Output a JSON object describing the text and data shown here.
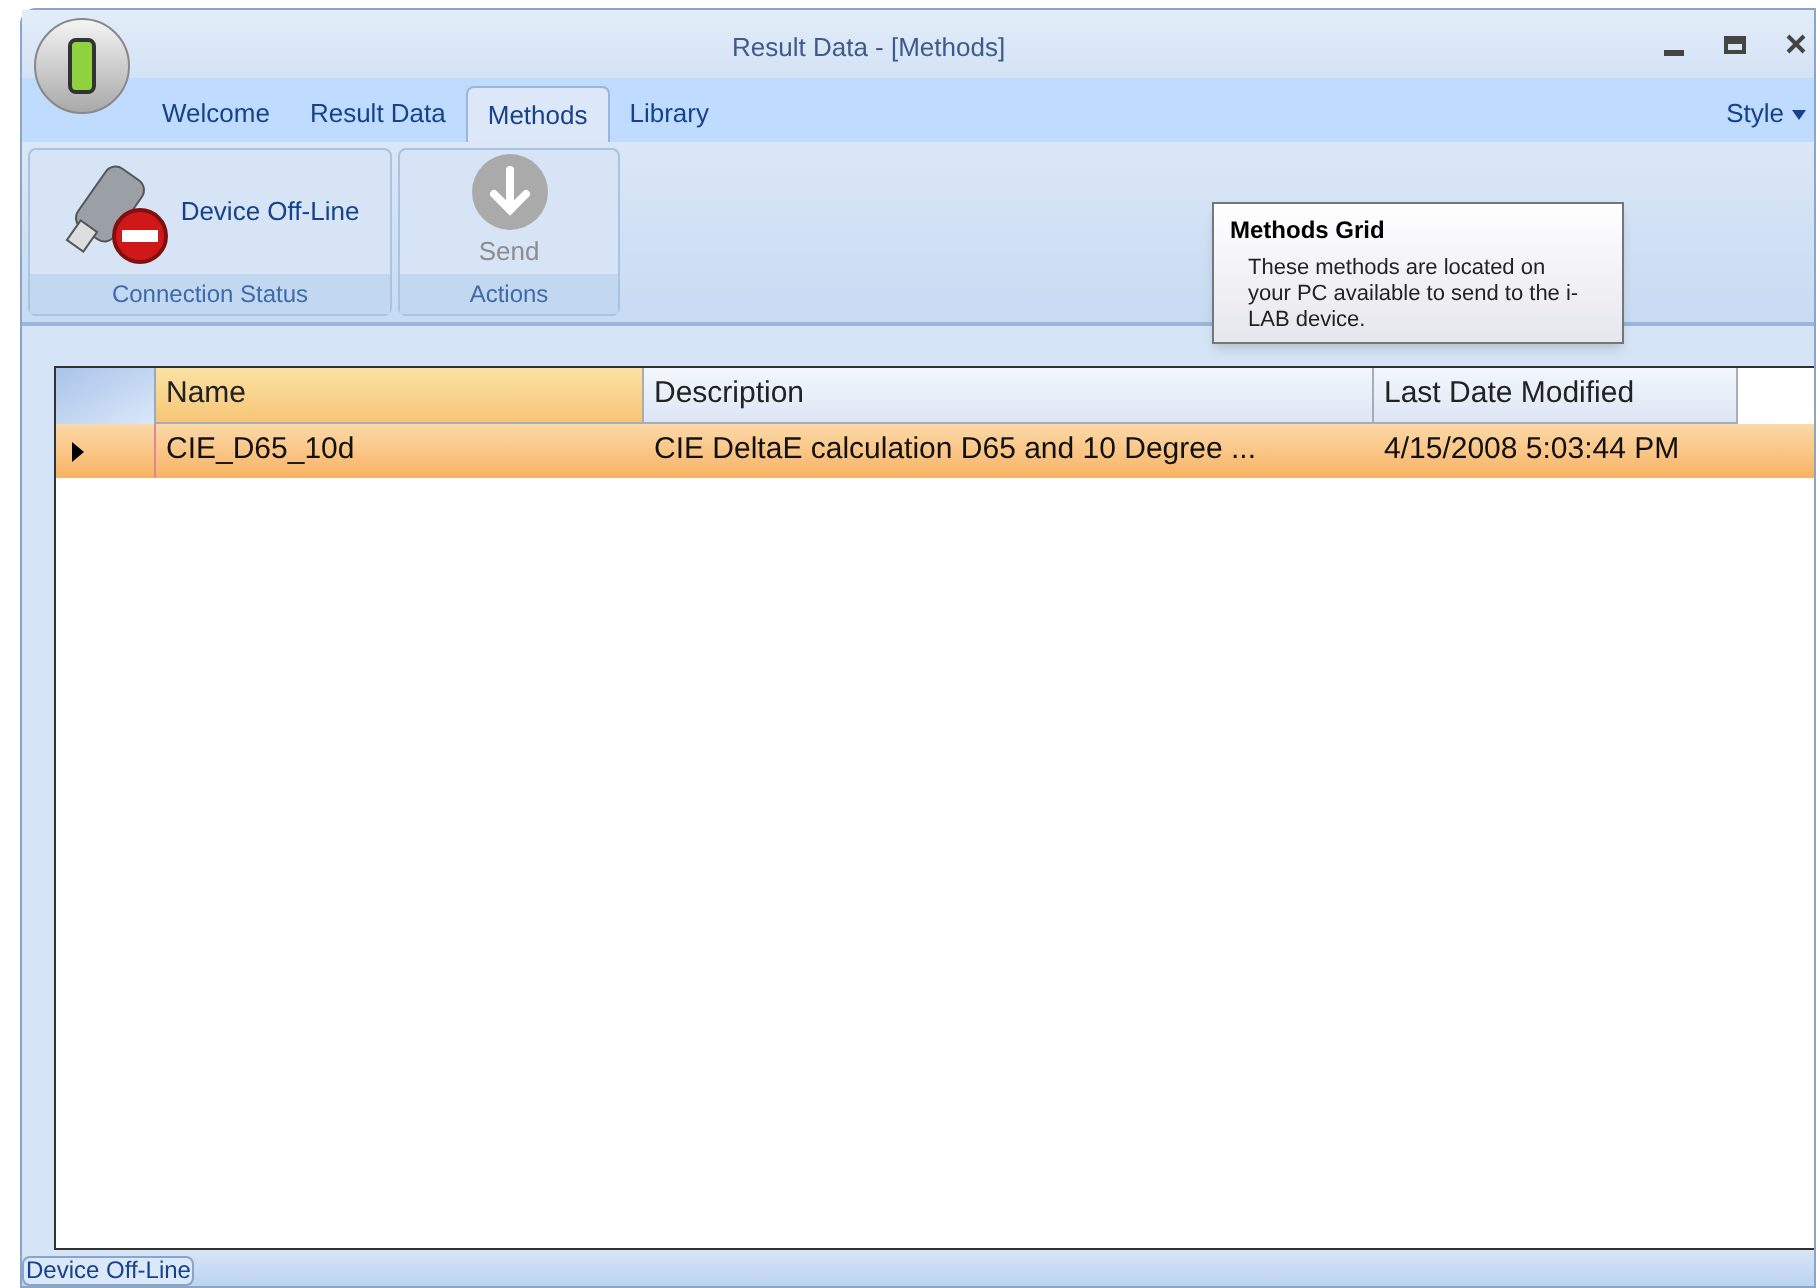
{
  "window": {
    "title": "Result Data - [Methods]"
  },
  "tabs": [
    {
      "label": "Welcome",
      "selected": false
    },
    {
      "label": "Result Data",
      "selected": false
    },
    {
      "label": "Methods",
      "selected": true
    },
    {
      "label": "Library",
      "selected": false
    }
  ],
  "style_menu": "Style",
  "ribbon_groups": [
    {
      "caption": "Connection Status",
      "button": {
        "label": "Device Off-Line",
        "disabled": false
      }
    },
    {
      "caption": "Actions",
      "button": {
        "label": "Send",
        "disabled": true
      }
    }
  ],
  "tooltip": {
    "title": "Methods Grid",
    "text": "These methods are located on your PC available to send to the i-LAB device."
  },
  "table": {
    "columns": [
      "Name",
      "Description",
      "Last Date Modified"
    ],
    "rows": [
      {
        "selected": true,
        "cells": [
          "CIE_D65_10d",
          "CIE DeltaE calculation D65 and 10 Degree ...",
          "4/15/2008 5:03:44 PM"
        ]
      }
    ]
  },
  "status_bar": {
    "text": "Device Off-Line"
  }
}
